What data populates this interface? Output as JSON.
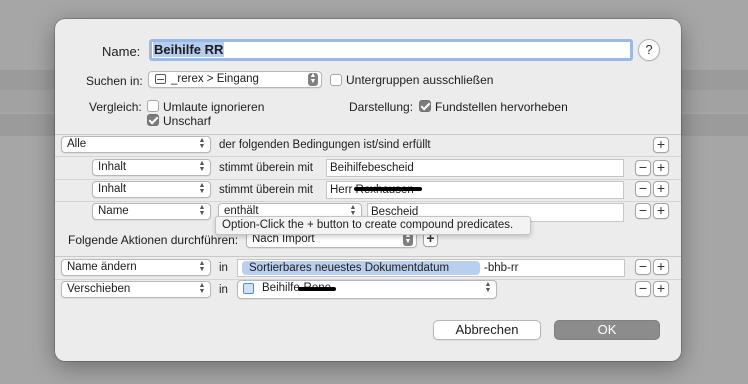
{
  "header": {
    "name_label": "Name:",
    "name_value": "Beihilfe RR",
    "help_label": "?"
  },
  "search": {
    "label": "Suchen in:",
    "location": "_rerex > Eingang",
    "exclude_subgroups": {
      "label": "Untergruppen ausschließen",
      "checked": false
    }
  },
  "compare": {
    "label": "Vergleich:",
    "ignore_umlauts": {
      "label": "Umlaute ignorieren",
      "checked": false
    },
    "fuzzy": {
      "label": "Unscharf",
      "checked": true
    }
  },
  "display": {
    "label": "Darstellung:",
    "highlight": {
      "label": "Fundstellen hervorheben",
      "checked": true
    }
  },
  "match": {
    "quantifier": "Alle",
    "text": "der folgenden Bedingungen ist/sind erfüllt",
    "add_label": "+"
  },
  "conditions": [
    {
      "field": "Inhalt",
      "operator": "stimmt überein mit",
      "value": "Beihilfebescheid"
    },
    {
      "field": "Inhalt",
      "operator": "stimmt überein mit",
      "value": "Herr Rexhausen"
    },
    {
      "field": "Name",
      "operator": "enthält",
      "value": "Bescheid"
    }
  ],
  "tooltip": "Option-Click the + button to create compound predicates.",
  "actions": {
    "label": "Folgende Aktionen durchführen:",
    "trigger": "Nach Import",
    "add_label": "+",
    "items": [
      {
        "action": "Name ändern",
        "preposition": "in",
        "token": "Sortierbares neuestes Dokumentdatum",
        "suffix": "-bhb-rr"
      },
      {
        "action": "Verschieben",
        "preposition": "in",
        "target": "Beihilfe-Rene"
      }
    ]
  },
  "buttons": {
    "minus": "−",
    "plus": "+",
    "cancel": "Abbrechen",
    "ok": "OK"
  },
  "colors": {
    "dialog_bg": "#ececec",
    "focus_ring": "#9ab8e8",
    "token_bg": "#b8cff0",
    "ok_button": "#8c8c8c"
  },
  "icons": {
    "location": "inbox-tray-icon",
    "target": "group-folder-icon",
    "chevron": "up-down-chevron-icon"
  }
}
